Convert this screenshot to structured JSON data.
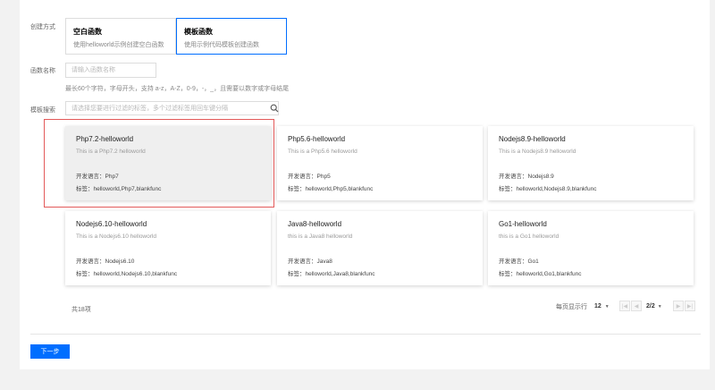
{
  "form": {
    "create_type_label": "创建方式",
    "options": [
      {
        "title": "空白函数",
        "desc": "使用helloworld示例创建空白函数"
      },
      {
        "title": "模板函数",
        "desc": "使用示例代码模板创建函数"
      }
    ],
    "name_label": "函数名称",
    "name_placeholder": "请输入函数名称",
    "name_value": "",
    "name_hint": "最长60个字符，字母开头，支持 a-z，A-Z，0-9，-，_，且需要以数字或字母结尾",
    "search_label": "模板搜索",
    "search_placeholder": "请选择您要进行过滤的标签，多个过滤标签用回车键分隔"
  },
  "cards": [
    {
      "name": "Php7.2-helloworld",
      "desc": "This is a Php7.2 helloworld",
      "lang_label": "开发语言：",
      "lang": "Php7",
      "tags_label": "标签：",
      "tags": "helloworld,Php7,blankfunc"
    },
    {
      "name": "Php5.6-helloworld",
      "desc": "This is a Php5.6 helloworld",
      "lang_label": "开发语言：",
      "lang": "Php5",
      "tags_label": "标签：",
      "tags": "helloworld,Php5,blankfunc"
    },
    {
      "name": "Nodejs8.9-helloworld",
      "desc": "This is a Nodejs8.9 helloworld",
      "lang_label": "开发语言：",
      "lang": "Nodejs8.9",
      "tags_label": "标签：",
      "tags": "helloworld,Nodejs8.9,blankfunc"
    },
    {
      "name": "Nodejs6.10-helloworld",
      "desc": "This is a Nodejs6.10 helloworld",
      "lang_label": "开发语言：",
      "lang": "Nodejs6.10",
      "tags_label": "标签：",
      "tags": "helloworld,Nodejs6.10,blankfunc"
    },
    {
      "name": "Java8-helloworld",
      "desc": "this is a Java8 helloworld",
      "lang_label": "开发语言：",
      "lang": "Java8",
      "tags_label": "标签：",
      "tags": "helloworld,Java8,blankfunc"
    },
    {
      "name": "Go1-helloworld",
      "desc": "this is a Go1 helloworld",
      "lang_label": "开发语言：",
      "lang": "Go1",
      "tags_label": "标签：",
      "tags": "helloworld,Go1,blankfunc"
    }
  ],
  "pagination": {
    "total": "共18项",
    "per_page_label": "每页显示行",
    "per_page": "12",
    "page": "2/2",
    "first_icon": "first-page-icon",
    "prev_icon": "prev-page-icon",
    "next_icon": "next-page-icon",
    "last_icon": "last-page-icon"
  },
  "actions": {
    "next_label": "下一步"
  },
  "colors": {
    "accent": "#006eff",
    "highlight": "#e35a5a"
  }
}
